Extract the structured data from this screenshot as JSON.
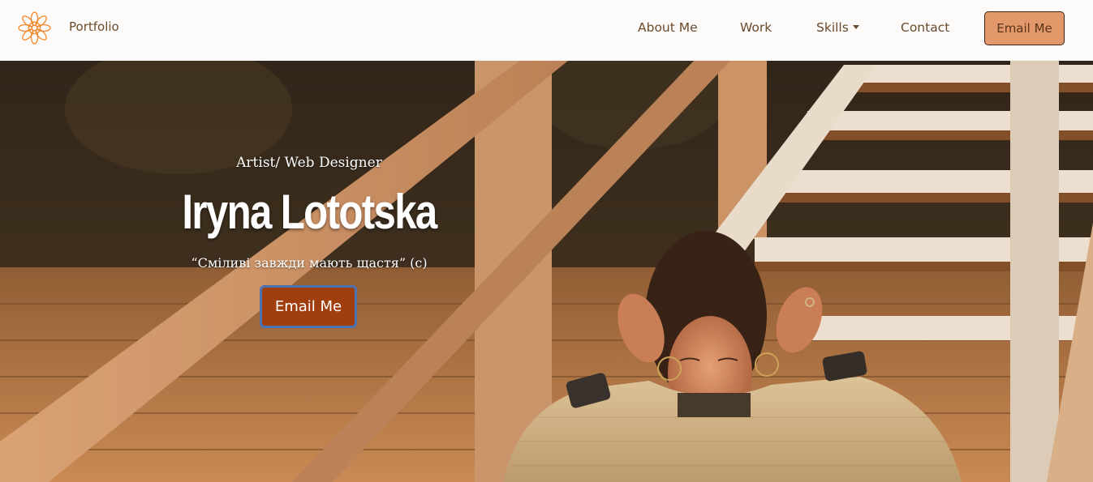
{
  "nav": {
    "brand": "Portfolio",
    "logo_icon": "orange-mandala-icon",
    "links": {
      "about": "About Me",
      "work": "Work",
      "skills": "Skills",
      "contact": "Contact"
    },
    "email_button": "Email Me"
  },
  "hero": {
    "subtitle": "Artist/ Web Designer",
    "name": "Iryna Lototska",
    "quote": "“Сміливі завжди мають щастя” (с)",
    "email_button": "Email Me"
  },
  "colors": {
    "accent": "#e3986b",
    "hero_button": "#a13e0d",
    "nav_text": "#6b4a2b"
  }
}
